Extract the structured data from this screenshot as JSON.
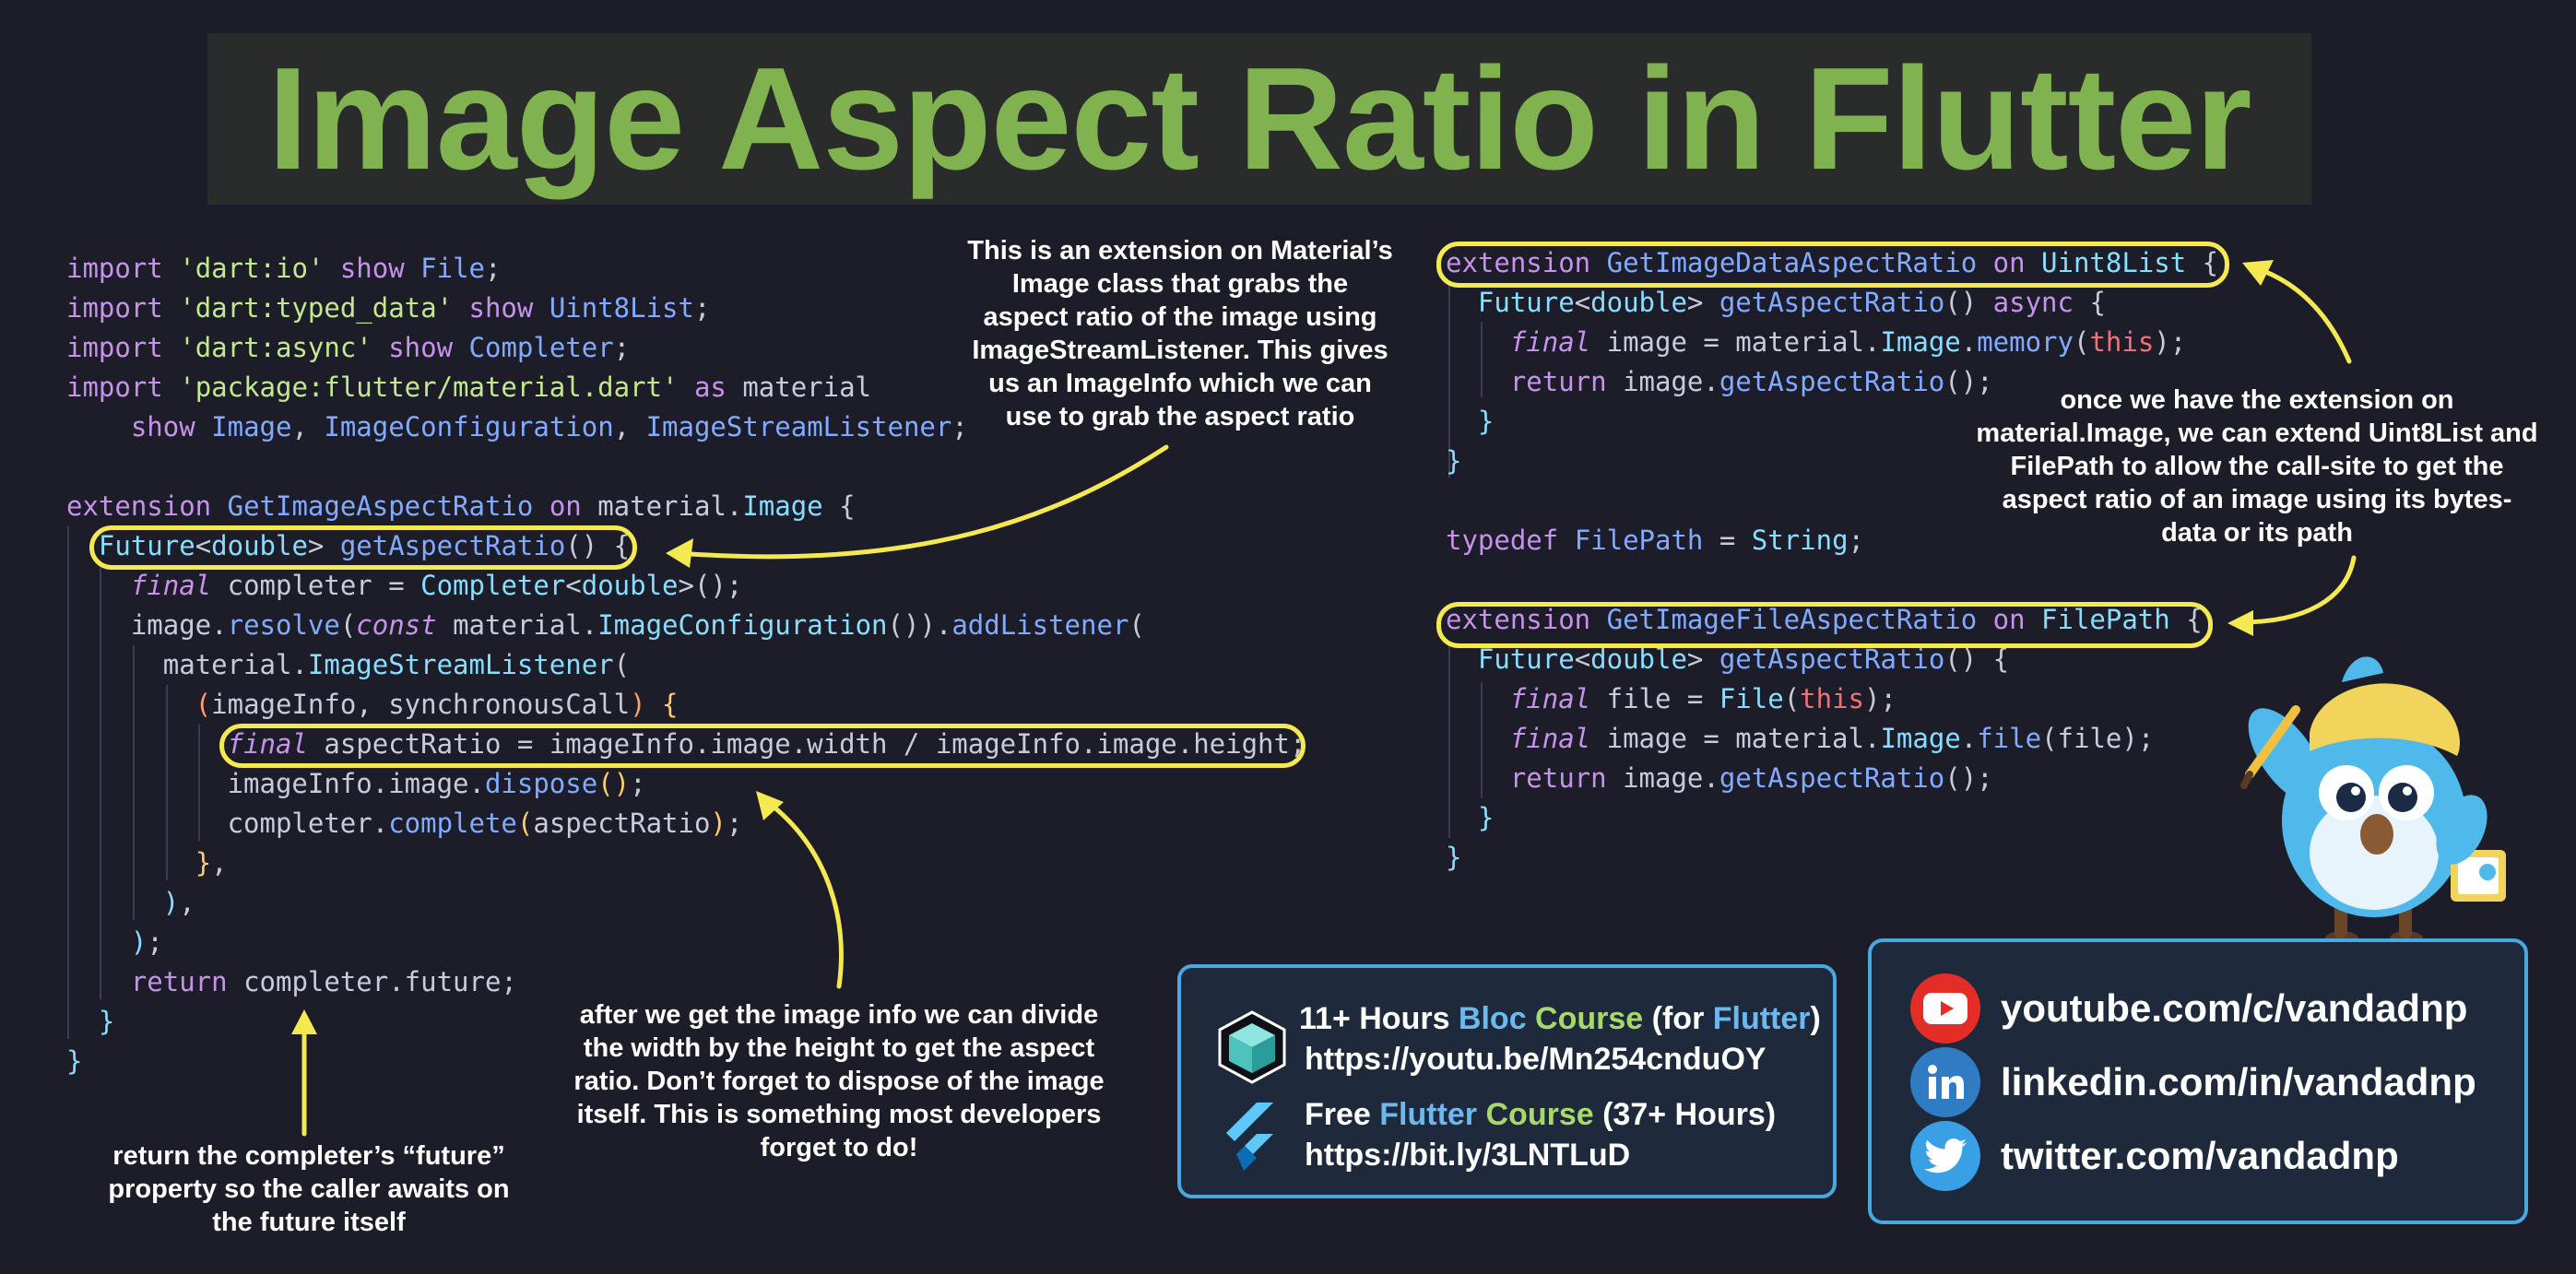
{
  "title": "Image Aspect Ratio in Flutter",
  "notes": {
    "extension_material": [
      "This is an extension on Material’s",
      "Image class that grabs the",
      "aspect ratio of the image using",
      "ImageStreamListener. This gives",
      "us an ImageInfo which we can",
      "use to grab the aspect ratio"
    ],
    "divide": [
      "after we get the image info we can divide",
      "the width by the height to get the aspect",
      "ratio. Don’t forget to dispose of the image",
      "itself. This is something most developers",
      "forget to do!"
    ],
    "return_future": [
      "return the completer’s “future”",
      "property so the caller awaits on",
      "the future itself"
    ],
    "extend_uint8list": [
      "once we have the extension on",
      "material.Image, we can extend Uint8List and",
      "FilePath to allow the call-site to get the",
      "aspect ratio of an image using its bytes-",
      "data or its path"
    ]
  },
  "promo": {
    "bloc": {
      "prefix": "11+ Hours ",
      "bloc": "Bloc",
      "course": " Course",
      "for_open": " (for ",
      "flutter": "Flutter",
      "for_close": ")",
      "url": "https://youtu.be/Mn254cnduOY"
    },
    "free": {
      "prefix": "Free ",
      "flutter": "Flutter",
      "course": " Course",
      "hours": " (37+ Hours)",
      "url": "https://bit.ly/3LNTLuD"
    }
  },
  "social": {
    "youtube": "youtube.com/c/vandadnp",
    "linkedin": "linkedin.com/in/vandadnp",
    "twitter": "twitter.com/vandadnp"
  },
  "colors": {
    "background": "#1c1d29",
    "title": "#80b34f",
    "highlight": "#f5e951",
    "promo_border": "#4aa8e0",
    "youtube": "#e52d27",
    "linkedin": "#2f7cc4",
    "twitter": "#3aa0e6"
  },
  "icons": [
    "youtube-icon",
    "linkedin-icon",
    "twitter-icon",
    "bloc-cube-icon",
    "flutter-logo-icon",
    "dash-mascot-icon"
  ]
}
